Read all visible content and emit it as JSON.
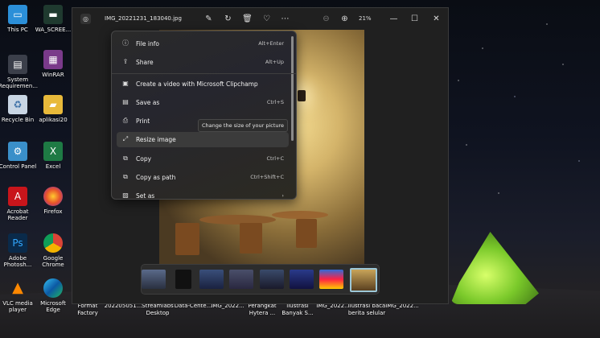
{
  "desktop": {
    "icons": [
      {
        "label": "This PC"
      },
      {
        "label": "WA_SCREE..."
      },
      {
        "label": "System Requiremen..."
      },
      {
        "label": "WinRAR"
      },
      {
        "label": "Recycle Bin"
      },
      {
        "label": "aplikasi20"
      },
      {
        "label": "Control Panel"
      },
      {
        "label": "Excel"
      },
      {
        "label": "Acrobat Reader"
      },
      {
        "label": "Firefox"
      },
      {
        "label": "Adobe Photosh..."
      },
      {
        "label": "Google Chrome"
      },
      {
        "label": "VLC media player"
      },
      {
        "label": "Microsoft Edge"
      }
    ],
    "bottom_row": [
      {
        "label": "Format Factory"
      },
      {
        "label": "202205051..."
      },
      {
        "label": "Streamlabs Desktop"
      },
      {
        "label": "Data-Cente..."
      },
      {
        "label": "IMG_2022..."
      },
      {
        "label": "Perangkat Hytera ..."
      },
      {
        "label": "ilustrasi Banyak S..."
      },
      {
        "label": "IMG_2022..."
      },
      {
        "label": "ilustrasi baca berita selular"
      },
      {
        "label": "IMG_2022..."
      }
    ]
  },
  "window": {
    "filename": "IMG_20221231_183040.jpg",
    "zoom": "21%",
    "toolbar_icons": [
      "edit-icon",
      "rotate-icon",
      "delete-icon",
      "favorite-icon",
      "more-icon"
    ]
  },
  "menu": {
    "items": [
      {
        "icon": "info-icon",
        "label": "File info",
        "shortcut": "Alt+Enter"
      },
      {
        "icon": "share-icon",
        "label": "Share",
        "shortcut": "Alt+Up"
      },
      {
        "icon": "clipchamp-icon",
        "label": "Create a video with Microsoft Clipchamp",
        "shortcut": ""
      },
      {
        "icon": "save-icon",
        "label": "Save as",
        "shortcut": "Ctrl+S"
      },
      {
        "icon": "print-icon",
        "label": "Print",
        "shortcut": ""
      },
      {
        "icon": "resize-icon",
        "label": "Resize image",
        "shortcut": ""
      },
      {
        "icon": "copy-icon",
        "label": "Copy",
        "shortcut": "Ctrl+C"
      },
      {
        "icon": "copy-path-icon",
        "label": "Copy as path",
        "shortcut": "Ctrl+Shift+C"
      },
      {
        "icon": "set-as-icon",
        "label": "Set as",
        "shortcut": "›"
      }
    ],
    "tooltip": "Change the size of your picture"
  },
  "colors": {
    "accent": "#9cc7d8",
    "tent": "#7ac92a"
  }
}
